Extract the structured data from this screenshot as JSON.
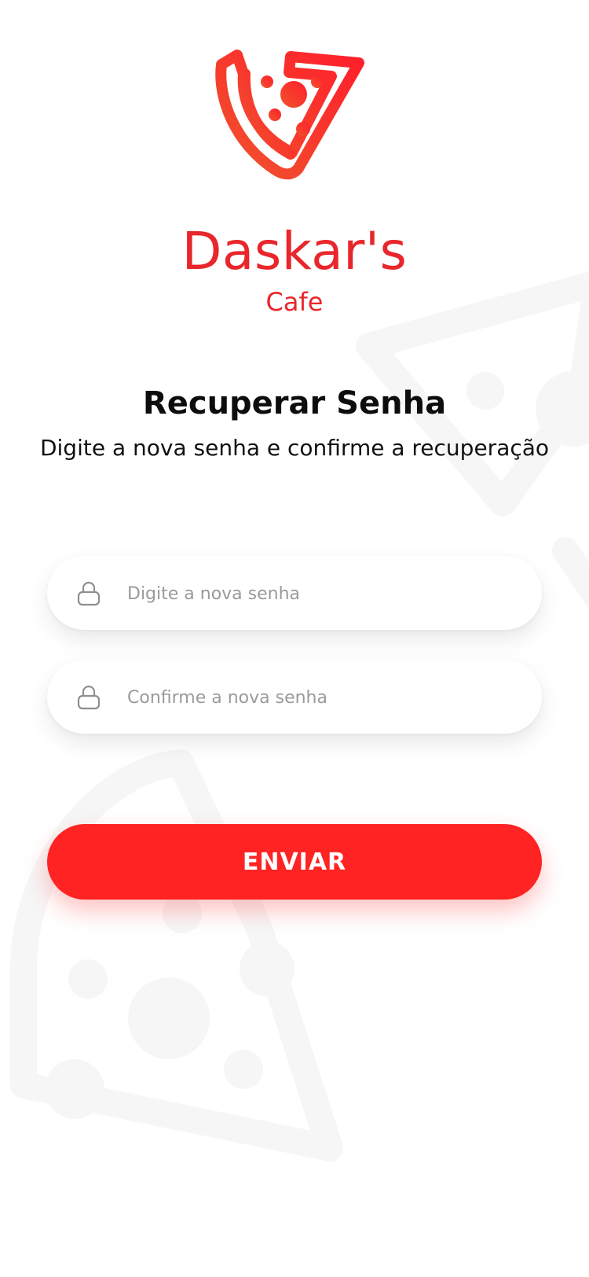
{
  "brand": {
    "name": "Daskar's",
    "sub": "Cafe"
  },
  "page": {
    "title": "Recuperar Senha",
    "subtitle": "Digite a nova senha e confirme a recuperação"
  },
  "form": {
    "new_password": {
      "placeholder": "Digite a nova senha",
      "value": "",
      "icon": "lock-icon"
    },
    "confirm_password": {
      "placeholder": "Confirme a nova senha",
      "value": "",
      "icon": "lock-icon"
    },
    "submit_label": "ENVIAR"
  },
  "colors": {
    "accent": "#ff2323",
    "brand": "#e8262b",
    "logo_gradient_start": "#f0532e",
    "logo_gradient_end": "#ff1f2b",
    "background_pattern": "#f6f6f6"
  }
}
